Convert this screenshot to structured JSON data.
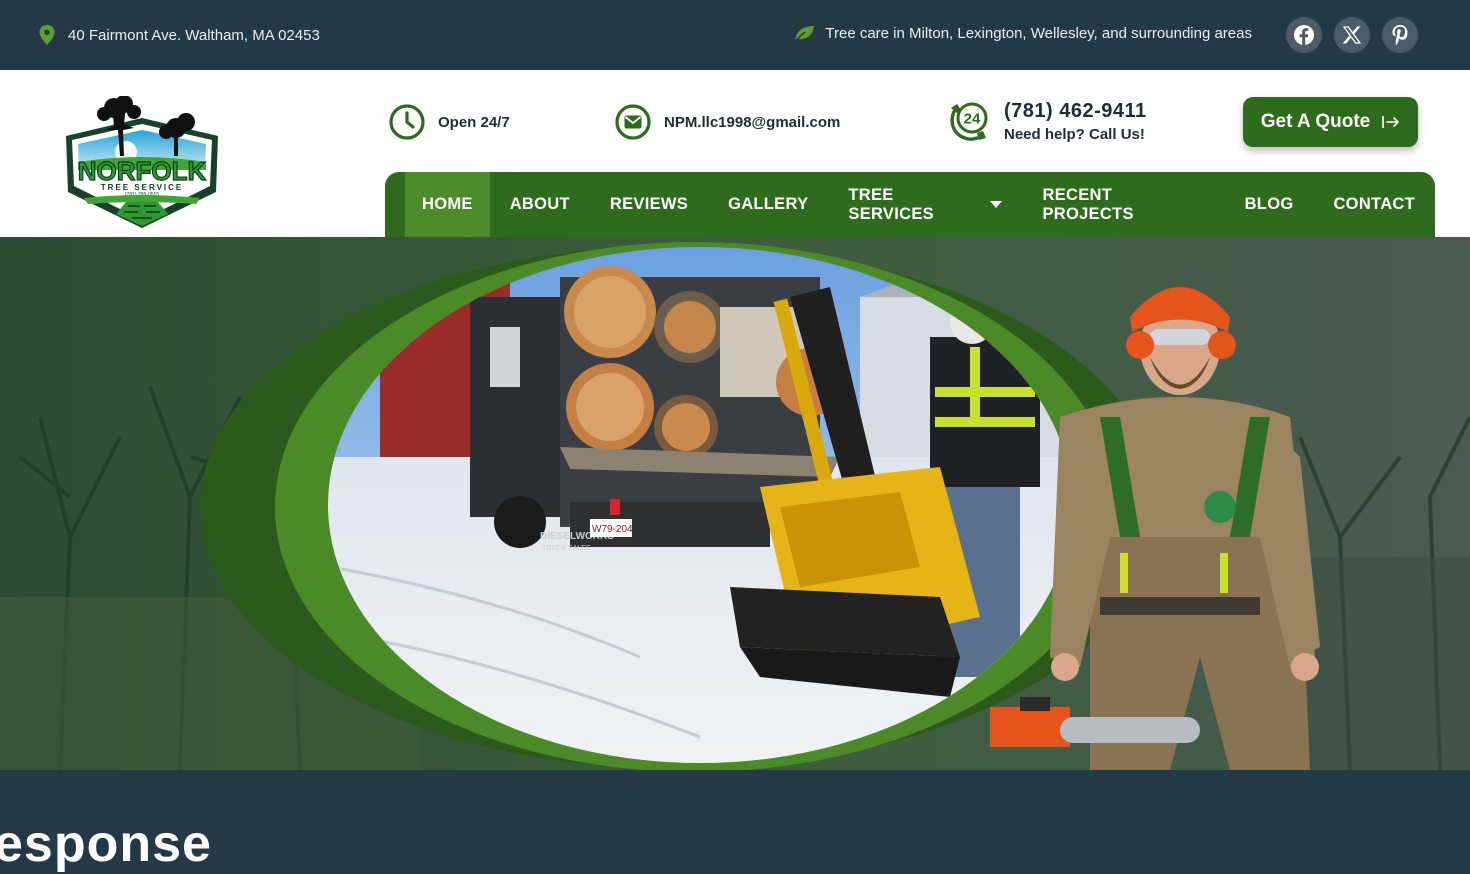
{
  "topbar": {
    "address": "40 Fairmont Ave. Waltham, MA 02453",
    "service_area": "Tree care in Milton, Lexington, Wellesley, and surrounding areas",
    "social": [
      {
        "icon": "facebook-icon",
        "glyph": "f"
      },
      {
        "icon": "x-icon",
        "glyph": "𝕏"
      },
      {
        "icon": "pinterest-icon",
        "glyph": "P"
      }
    ]
  },
  "logo": {
    "name": "NORFOLK",
    "subtitle": "TREE SERVICE",
    "phone_small": "(781) 295-0515"
  },
  "header": {
    "hours": "Open 24/7",
    "email": "NPM.llc1998@gmail.com",
    "phone": "(781) 462-9411",
    "phone_note": "Need help? Call Us!",
    "badge_24": "24",
    "quote_button": "Get A Quote"
  },
  "nav": {
    "items": [
      "HOME",
      "ABOUT",
      "REVIEWS",
      "GALLERY",
      "TREE SERVICES",
      "RECENT PROJECTS",
      "BLOG",
      "CONTACT"
    ],
    "active": "HOME"
  },
  "hero": {
    "truck_text": "DIESELWORKS",
    "truck_sub": "TRUCK SALES",
    "plate": "W79-204"
  },
  "bottom": {
    "partial_heading": "esponse"
  },
  "colors": {
    "topbar_bg": "#243845",
    "brand_green": "#2e6b1c",
    "active_green": "#4d8a2a",
    "accent_green": "#5aa02c"
  }
}
